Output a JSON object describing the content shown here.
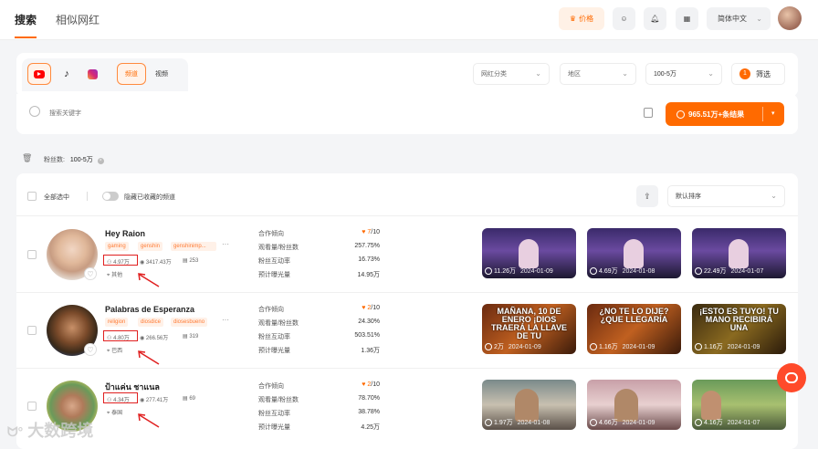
{
  "header": {
    "tabs": [
      "搜索",
      "相似网红"
    ],
    "price_label": "价格",
    "language": "简体中文"
  },
  "filters": {
    "content_types": [
      "频道",
      "视频"
    ],
    "category_placeholder": "网红分类",
    "region_placeholder": "地区",
    "followers_value": "100-5万",
    "filter_count": "1",
    "filter_label": "筛选",
    "search_placeholder": "搜索关键字",
    "results_label": "965.51万+条结果",
    "active_chip_label": "粉丝数:",
    "active_chip_value": "100-5万"
  },
  "list_header": {
    "select_all": "全部选中",
    "hide_collected": "隐藏已收藏的频道",
    "sort": "默认排序"
  },
  "metric_labels": [
    "合作倾向",
    "观看量/粉丝数",
    "粉丝互动率",
    "预计曝光量"
  ],
  "rows": [
    {
      "name": "Hey Raion",
      "tags": [
        "gaming",
        "genshin",
        "genshinimp..."
      ],
      "followers": "4.97万",
      "views": "3417.43万",
      "videos": "253",
      "region": "其他",
      "coop": "7",
      "coop_max": "/10",
      "ratio": "257.75%",
      "engagement": "16.73%",
      "exposure": "14.95万",
      "videos_list": [
        {
          "views": "11.26万",
          "date": "2024-01-09",
          "title": ""
        },
        {
          "views": "4.69万",
          "date": "2024-01-08",
          "title": ""
        },
        {
          "views": "22.49万",
          "date": "2024-01-07",
          "title": ""
        }
      ]
    },
    {
      "name": "Palabras de Esperanza",
      "tags": [
        "religion",
        "diosdice",
        "diosesbueno"
      ],
      "followers": "4.80万",
      "views": "266.56万",
      "videos": "319",
      "region": "巴西",
      "coop": "2",
      "coop_max": "/10",
      "ratio": "24.30%",
      "engagement": "503.51%",
      "exposure": "1.36万",
      "videos_list": [
        {
          "views": "2万",
          "date": "2024-01-09",
          "title": "MAÑANA, 10 DE ENERO ¡DIOS TRAERÁ LA LLAVE DE TU"
        },
        {
          "views": "1.16万",
          "date": "2024-01-09",
          "title": "¿NO TE LO DIJE? ¿QUE LLEGARÍA"
        },
        {
          "views": "1.16万",
          "date": "2024-01-09",
          "title": "¡ESTO ES TUYO! TU MANO RECIBIRÁ UNA"
        }
      ]
    },
    {
      "name": "ป้าแค่น ชาแนล",
      "tags": [],
      "followers": "4.34万",
      "views": "277.41万",
      "videos": "69",
      "region": "泰国",
      "coop": "2",
      "coop_max": "/10",
      "ratio": "78.70%",
      "engagement": "38.78%",
      "exposure": "4.25万",
      "videos_list": [
        {
          "views": "1.97万",
          "date": "2024-01-08",
          "title": ""
        },
        {
          "views": "4.66万",
          "date": "2024-01-09",
          "title": ""
        },
        {
          "views": "4.16万",
          "date": "2024-01-07",
          "title": ""
        }
      ]
    }
  ],
  "watermark": "大数跨境",
  "colors": {
    "accent": "#ff6a00",
    "annotation": "#e02020"
  }
}
